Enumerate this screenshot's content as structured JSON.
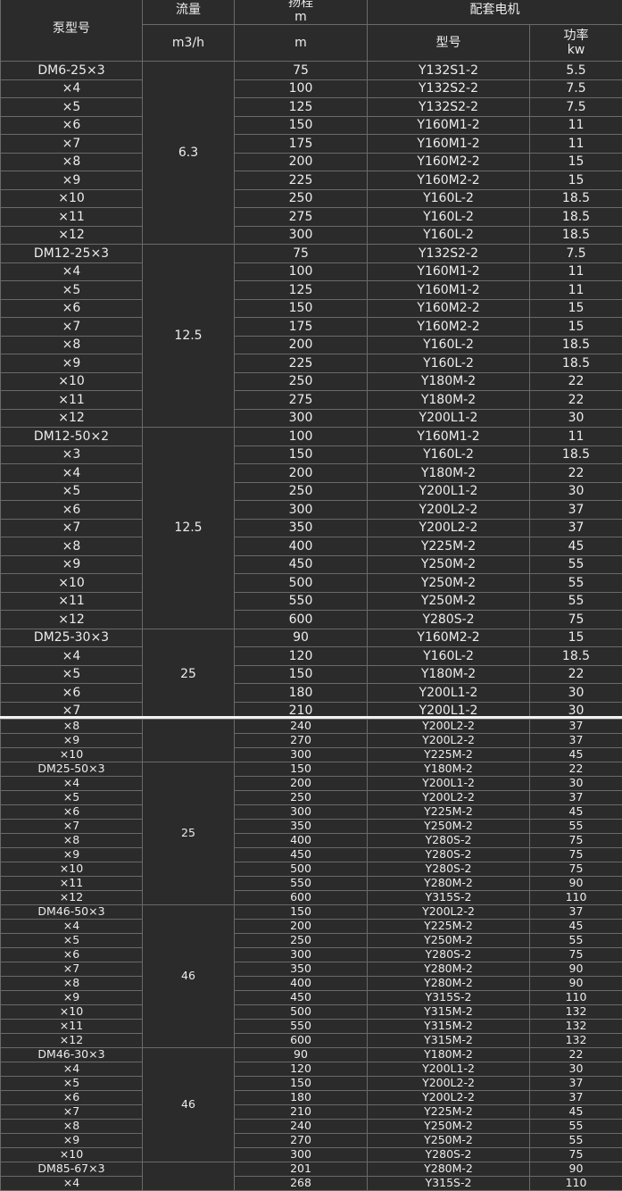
{
  "header": {
    "model": "泵型号",
    "flow": "流量",
    "flow_unit": "m3/h",
    "head_top": "扬程",
    "head_top_unit": "m",
    "head_unit": "m",
    "motor": "配套电机",
    "motor_model": "型号",
    "power": "功率",
    "power_unit": "kw"
  },
  "groups_part1": [
    {
      "flow": "6.3",
      "rows": [
        [
          "DM6-25×3",
          "75",
          "Y132S1-2",
          "5.5"
        ],
        [
          "×4",
          "100",
          "Y132S2-2",
          "7.5"
        ],
        [
          "×5",
          "125",
          "Y132S2-2",
          "7.5"
        ],
        [
          "×6",
          "150",
          "Y160M1-2",
          "11"
        ],
        [
          "×7",
          "175",
          "Y160M1-2",
          "11"
        ],
        [
          "×8",
          "200",
          "Y160M2-2",
          "15"
        ],
        [
          "×9",
          "225",
          "Y160M2-2",
          "15"
        ],
        [
          "×10",
          "250",
          "Y160L-2",
          "18.5"
        ],
        [
          "×11",
          "275",
          "Y160L-2",
          "18.5"
        ],
        [
          "×12",
          "300",
          "Y160L-2",
          "18.5"
        ]
      ]
    },
    {
      "flow": "12.5",
      "rows": [
        [
          "DM12-25×3",
          "75",
          "Y132S2-2",
          "7.5"
        ],
        [
          "×4",
          "100",
          "Y160M1-2",
          "11"
        ],
        [
          "×5",
          "125",
          "Y160M1-2",
          "11"
        ],
        [
          "×6",
          "150",
          "Y160M2-2",
          "15"
        ],
        [
          "×7",
          "175",
          "Y160M2-2",
          "15"
        ],
        [
          "×8",
          "200",
          "Y160L-2",
          "18.5"
        ],
        [
          "×9",
          "225",
          "Y160L-2",
          "18.5"
        ],
        [
          "×10",
          "250",
          "Y180M-2",
          "22"
        ],
        [
          "×11",
          "275",
          "Y180M-2",
          "22"
        ],
        [
          "×12",
          "300",
          "Y200L1-2",
          "30"
        ]
      ]
    },
    {
      "flow": "12.5",
      "rows": [
        [
          "DM12-50×2",
          "100",
          "Y160M1-2",
          "11"
        ],
        [
          "×3",
          "150",
          "Y160L-2",
          "18.5"
        ],
        [
          "×4",
          "200",
          "Y180M-2",
          "22"
        ],
        [
          "×5",
          "250",
          "Y200L1-2",
          "30"
        ],
        [
          "×6",
          "300",
          "Y200L2-2",
          "37"
        ],
        [
          "×7",
          "350",
          "Y200L2-2",
          "37"
        ],
        [
          "×8",
          "400",
          "Y225M-2",
          "45"
        ],
        [
          "×9",
          "450",
          "Y250M-2",
          "55"
        ],
        [
          "×10",
          "500",
          "Y250M-2",
          "55"
        ],
        [
          "×11",
          "550",
          "Y250M-2",
          "55"
        ],
        [
          "×12",
          "600",
          "Y280S-2",
          "75"
        ]
      ]
    },
    {
      "flow": "25",
      "rows": [
        [
          "DM25-30×3",
          "90",
          "Y160M2-2",
          "15"
        ],
        [
          "×4",
          "120",
          "Y160L-2",
          "18.5"
        ],
        [
          "×5",
          "150",
          "Y180M-2",
          "22"
        ],
        [
          "×6",
          "180",
          "Y200L1-2",
          "30"
        ],
        [
          "×7",
          "210",
          "Y200L1-2",
          "30"
        ]
      ]
    }
  ],
  "groups_part2": [
    {
      "flow": "",
      "rows": [
        [
          "×8",
          "240",
          "Y200L2-2",
          "37"
        ],
        [
          "×9",
          "270",
          "Y200L2-2",
          "37"
        ],
        [
          "×10",
          "300",
          "Y225M-2",
          "45"
        ]
      ]
    },
    {
      "flow": "25",
      "rows": [
        [
          "DM25-50×3",
          "150",
          "Y180M-2",
          "22"
        ],
        [
          "×4",
          "200",
          "Y200L1-2",
          "30"
        ],
        [
          "×5",
          "250",
          "Y200L2-2",
          "37"
        ],
        [
          "×6",
          "300",
          "Y225M-2",
          "45"
        ],
        [
          "×7",
          "350",
          "Y250M-2",
          "55"
        ],
        [
          "×8",
          "400",
          "Y280S-2",
          "75"
        ],
        [
          "×9",
          "450",
          "Y280S-2",
          "75"
        ],
        [
          "×10",
          "500",
          "Y280S-2",
          "75"
        ],
        [
          "×11",
          "550",
          "Y280M-2",
          "90"
        ],
        [
          "×12",
          "600",
          "Y315S-2",
          "110"
        ]
      ]
    },
    {
      "flow": "46",
      "rows": [
        [
          "DM46-50×3",
          "150",
          "Y200L2-2",
          "37"
        ],
        [
          "×4",
          "200",
          "Y225M-2",
          "45"
        ],
        [
          "×5",
          "250",
          "Y250M-2",
          "55"
        ],
        [
          "×6",
          "300",
          "Y280S-2",
          "75"
        ],
        [
          "×7",
          "350",
          "Y280M-2",
          "90"
        ],
        [
          "×8",
          "400",
          "Y280M-2",
          "90"
        ],
        [
          "×9",
          "450",
          "Y315S-2",
          "110"
        ],
        [
          "×10",
          "500",
          "Y315M-2",
          "132"
        ],
        [
          "×11",
          "550",
          "Y315M-2",
          "132"
        ],
        [
          "×12",
          "600",
          "Y315M-2",
          "132"
        ]
      ]
    },
    {
      "flow": "46",
      "rows": [
        [
          "DM46-30×3",
          "90",
          "Y180M-2",
          "22"
        ],
        [
          "×4",
          "120",
          "Y200L1-2",
          "30"
        ],
        [
          "×5",
          "150",
          "Y200L2-2",
          "37"
        ],
        [
          "×6",
          "180",
          "Y200L2-2",
          "37"
        ],
        [
          "×7",
          "210",
          "Y225M-2",
          "45"
        ],
        [
          "×8",
          "240",
          "Y250M-2",
          "55"
        ],
        [
          "×9",
          "270",
          "Y250M-2",
          "55"
        ],
        [
          "×10",
          "300",
          "Y280S-2",
          "75"
        ]
      ]
    },
    {
      "flow": "",
      "rows": [
        [
          "DM85-67×3",
          "201",
          "Y280M-2",
          "90"
        ],
        [
          "×4",
          "268",
          "Y315S-2",
          "110"
        ]
      ]
    }
  ]
}
